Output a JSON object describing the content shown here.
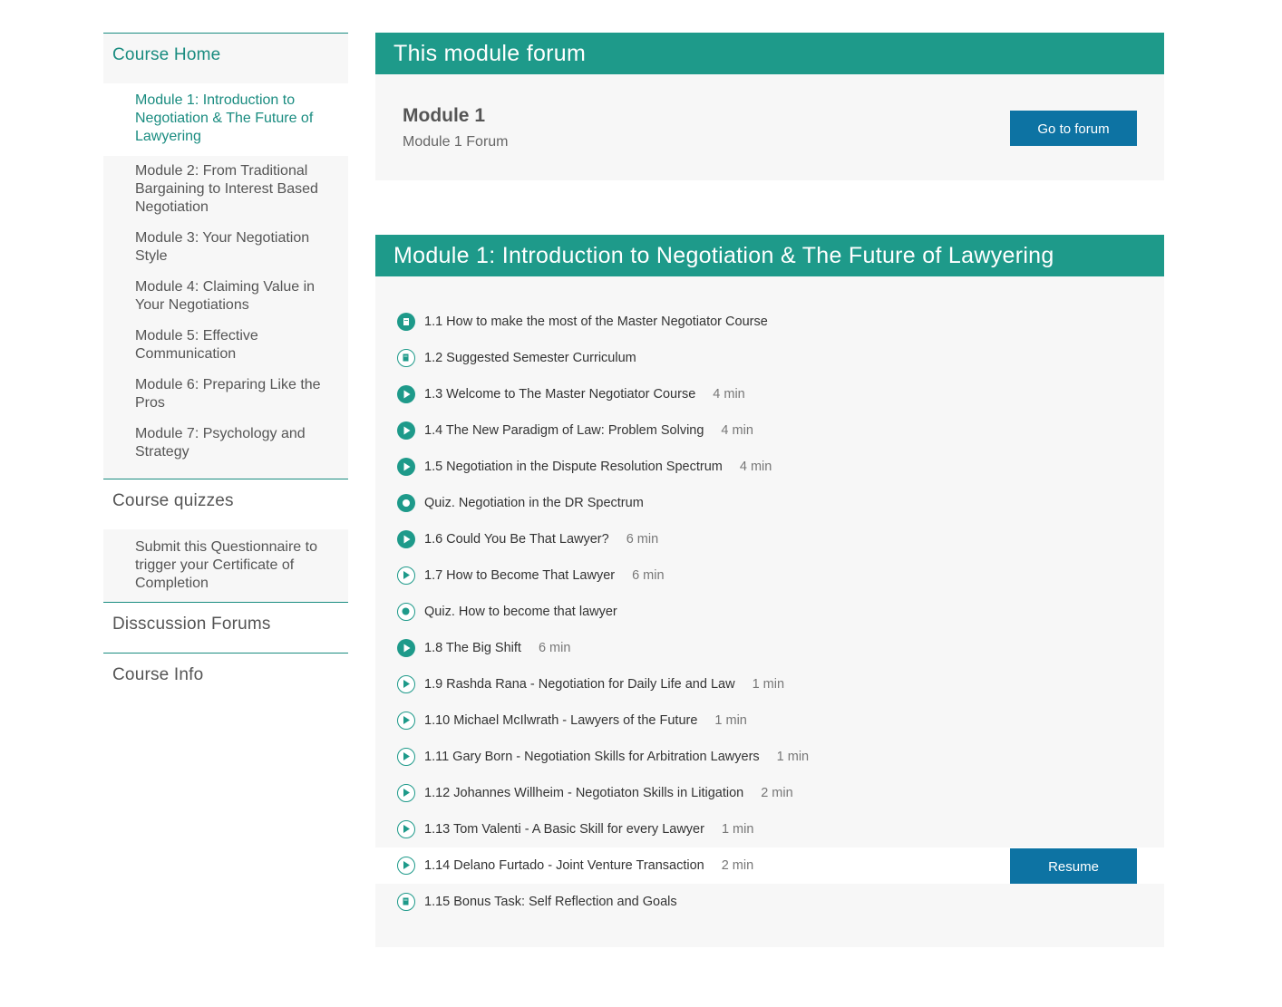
{
  "sidebar": {
    "course_home": "Course Home",
    "modules": [
      "Module 1: Introduction to Negotiation & The Future of Lawyering",
      "Module 2: From Traditional Bargaining to Interest Based Negotiation",
      "Module 3: Your Negotiation Style",
      "Module 4: Claiming Value in Your Negotiations",
      "Module 5: Effective Communication",
      "Module 6: Preparing Like the Pros",
      "Module 7: Psychology and Strategy"
    ],
    "course_quizzes": "Course quizzes",
    "quiz_items": [
      "Submit this Questionnaire to trigger your Certificate of Completion"
    ],
    "discussion_forums": "Disscussion Forums",
    "course_info": "Course Info"
  },
  "forum": {
    "header": "This module forum",
    "title": "Module 1",
    "subtitle": "Module 1 Forum",
    "button": "Go to forum"
  },
  "module": {
    "header": "Module 1: Introduction to Negotiation & The Future of Lawyering",
    "resume_label": "Resume",
    "lessons": [
      {
        "label": "1.1 How to make the most of the Master Negotiator Course",
        "duration": "",
        "icon": "document-icon",
        "done": true
      },
      {
        "label": "1.2 Suggested Semester Curriculum",
        "duration": "",
        "icon": "document-icon",
        "done": false
      },
      {
        "label": "1.3 Welcome to The Master Negotiator Course",
        "duration": "4 min",
        "icon": "play-icon",
        "done": true
      },
      {
        "label": "1.4 The New Paradigm of Law: Problem Solving",
        "duration": "4 min",
        "icon": "play-icon",
        "done": true
      },
      {
        "label": "1.5 Negotiation in the Dispute Resolution Spectrum",
        "duration": "4 min",
        "icon": "play-icon",
        "done": true
      },
      {
        "label": "Quiz. Negotiation in the DR Spectrum",
        "duration": "",
        "icon": "quiz-icon",
        "done": true
      },
      {
        "label": "1.6 Could You Be That Lawyer?",
        "duration": "6 min",
        "icon": "play-icon",
        "done": true
      },
      {
        "label": "1.7 How to Become That Lawyer",
        "duration": "6 min",
        "icon": "play-icon",
        "done": false
      },
      {
        "label": "Quiz. How to become that lawyer",
        "duration": "",
        "icon": "quiz-icon",
        "done": false
      },
      {
        "label": "1.8 The Big Shift",
        "duration": "6 min",
        "icon": "play-icon",
        "done": true
      },
      {
        "label": "1.9 Rashda Rana - Negotiation for Daily Life and Law",
        "duration": "1 min",
        "icon": "play-icon",
        "done": false
      },
      {
        "label": "1.10 Michael McIlwrath - Lawyers of the Future",
        "duration": "1 min",
        "icon": "play-icon",
        "done": false
      },
      {
        "label": "1.11 Gary Born - Negotiation Skills for Arbitration Lawyers",
        "duration": "1 min",
        "icon": "play-icon",
        "done": false
      },
      {
        "label": "1.12 Johannes Willheim - Negotiaton Skills in Litigation",
        "duration": "2 min",
        "icon": "play-icon",
        "done": false
      },
      {
        "label": "1.13 Tom Valenti - A Basic Skill for every Lawyer",
        "duration": "1 min",
        "icon": "play-icon",
        "done": false
      },
      {
        "label": "1.14 Delano Furtado - Joint Venture Transaction",
        "duration": "2 min",
        "icon": "play-icon",
        "done": false,
        "current": true
      },
      {
        "label": "1.15 Bonus Task: Self Reflection and Goals",
        "duration": "",
        "icon": "document-icon",
        "done": false
      }
    ]
  },
  "colors": {
    "accent": "#1e9a8a",
    "button": "#0d73a3",
    "panel_bg": "#f7f7f7"
  }
}
